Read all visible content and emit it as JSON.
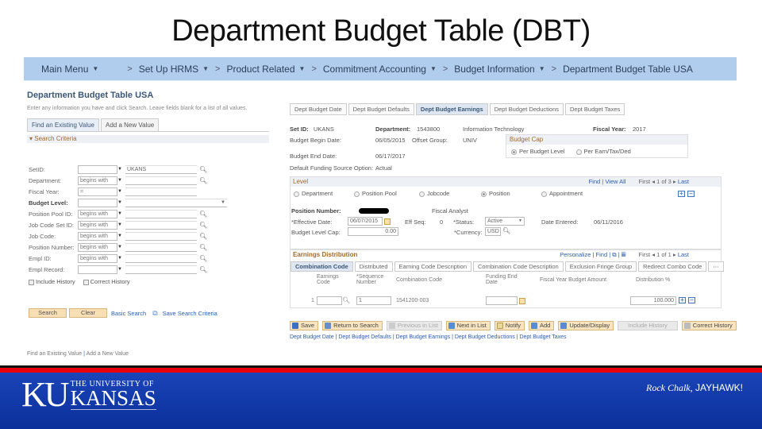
{
  "slide": {
    "title": "Department Budget Table (DBT)"
  },
  "navbar": {
    "crumbs": [
      {
        "label": "Main Menu",
        "dropdown": true
      },
      {
        "label": "Set Up HRMS",
        "dropdown": true
      },
      {
        "label": "Product Related",
        "dropdown": true
      },
      {
        "label": "Commitment Accounting",
        "dropdown": true
      },
      {
        "label": "Budget Information",
        "dropdown": true
      },
      {
        "label": "Department Budget Table USA",
        "dropdown": false
      }
    ],
    "caret": "▼",
    "separator": ">"
  },
  "search_page": {
    "title": "Department Budget Table USA",
    "instructions": "Enter any information you have and click Search. Leave fields blank for a list of all values.",
    "tabs": [
      "Find an Existing Value",
      "Add a New Value"
    ],
    "criteria_header": "Search Criteria",
    "fields": [
      {
        "label": "SetID:",
        "operator": "",
        "value": "UKANS",
        "lookup": true
      },
      {
        "label": "Department:",
        "operator": "begins with",
        "value": "",
        "lookup": true
      },
      {
        "label": "Fiscal Year:",
        "operator": "=",
        "value": "",
        "lookup": false
      },
      {
        "label": "Budget Level:",
        "operator": "",
        "value": "",
        "lookup": false,
        "select": true
      },
      {
        "label": "Position Pool ID:",
        "operator": "begins with",
        "value": "",
        "lookup": true
      },
      {
        "label": "Job Code Set ID:",
        "operator": "begins with",
        "value": "",
        "lookup": true
      },
      {
        "label": "Job Code:",
        "operator": "begins with",
        "value": "",
        "lookup": true
      },
      {
        "label": "Position Number:",
        "operator": "begins with",
        "value": "",
        "lookup": true
      },
      {
        "label": "Empl ID:",
        "operator": "begins with",
        "value": "",
        "lookup": true
      },
      {
        "label": "Empl Record:",
        "operator": "",
        "value": "",
        "lookup": true
      }
    ],
    "checkboxes": [
      "Include History",
      "Correct History"
    ],
    "search_button": "Search",
    "clear_button": "Clear",
    "basic_search_link": "Basic Search",
    "save_criteria_link": "Save Search Criteria",
    "footer_links": [
      "Find an Existing Value",
      "Add a New Value"
    ]
  },
  "detail_page": {
    "tabs": [
      "Dept Budget Date",
      "Dept Budget Defaults",
      "Dept Budget Earnings",
      "Dept Budget Deductions",
      "Dept Budget Taxes"
    ],
    "active_tab": 2,
    "header": {
      "setid_label": "Set ID:",
      "setid": "UKANS",
      "department_label": "Department:",
      "department": "1543800",
      "department_desc": "Information Technology",
      "fiscal_year_label": "Fiscal Year:",
      "fiscal_year": "2017",
      "begin_date_label": "Budget Begin Date:",
      "begin_date": "06/05/2015",
      "offset_group_label": "Offset Group:",
      "offset_group": "UNIV",
      "end_date_label": "Budget End Date:",
      "end_date": "06/17/2017",
      "default_funding_label": "Default Funding Source Option:",
      "default_funding": "Actual"
    },
    "budget_cap": {
      "title": "Budget Cap",
      "options": [
        "Per Budget Level",
        "Per Earn/Tax/Ded"
      ],
      "selected": 0
    },
    "level": {
      "title": "Level",
      "nav": {
        "find": "Find",
        "view_all": "View All",
        "first": "First",
        "count": "1 of 3",
        "last": "Last"
      },
      "options": [
        "Department",
        "Position Pool",
        "Jobcode",
        "Position",
        "Appointment"
      ],
      "selected": 3,
      "position_number_label": "Position Number:",
      "position_desc": "Fiscal Analyst",
      "effective_date_label": "*Effective Date:",
      "effective_date": "06/07/2015",
      "eff_seq_label": "Eff Seq:",
      "eff_seq": "0",
      "status_label": "*Status:",
      "status": "Active",
      "date_entered_label": "Date Entered:",
      "date_entered": "06/11/2016",
      "budget_level_cap_label": "Budget Level Cap:",
      "budget_level_cap": "0.00",
      "currency_label": "*Currency:",
      "currency": "USD"
    },
    "earnings": {
      "title": "Earnings Distribution",
      "nav": {
        "personalize": "Personalize",
        "find": "Find",
        "first": "First",
        "count": "1 of 1",
        "last": "Last"
      },
      "tabs": [
        "Combination Code",
        "Distributed",
        "Earning Code Description",
        "Combination Code Description",
        "Exclusion Fringe Group",
        "Redirect Combo Code"
      ],
      "columns": [
        "Earnings Code",
        "*Sequence Number",
        "Combination Code",
        "Funding End Date",
        "Fiscal Year Budget Amount",
        "Distribution %"
      ],
      "rows": [
        {
          "row": "1",
          "earnings_code": "",
          "sequence": "1",
          "combination_code": "1541200-003",
          "funding_end_date": "",
          "budget_amount": "",
          "distribution": "100.000"
        }
      ]
    },
    "toolbar": [
      {
        "label": "Save",
        "enabled": true,
        "icon": "save-icon",
        "color": "#3b6fc4"
      },
      {
        "label": "Return to Search",
        "enabled": true,
        "icon": "return-icon",
        "color": "#6a8fc4"
      },
      {
        "label": "Previous in List",
        "enabled": false,
        "icon": "previous-icon",
        "color": "#bbb"
      },
      {
        "label": "Next in List",
        "enabled": true,
        "icon": "next-icon",
        "color": "#5a8ad0"
      },
      {
        "label": "Notify",
        "enabled": true,
        "icon": "notify-icon",
        "color": "#d7c27b"
      },
      {
        "label": "Add",
        "enabled": true,
        "icon": "add-icon",
        "color": "#5a8ad0"
      },
      {
        "label": "Update/Display",
        "enabled": true,
        "icon": "update-icon",
        "color": "#5a8ad0"
      },
      {
        "label": "Include History",
        "enabled": false,
        "icon": "",
        "color": ""
      },
      {
        "label": "Correct History",
        "enabled": true,
        "icon": "correct-icon",
        "color": "#aaa"
      }
    ],
    "bottom_links": [
      "Dept Budget Date",
      "Dept Budget Defaults",
      "Dept Budget Earnings",
      "Dept Budget Deductions",
      "Dept Budget Taxes"
    ]
  },
  "branding": {
    "ku": "KU",
    "university_line": "THE UNIVERSITY OF",
    "kansas": "KANSAS",
    "slogan_italic": "Rock Chalk,",
    "slogan_caps": "JAYHAWK!",
    "colors": {
      "blue": "#0b2f9a",
      "red": "#e8000d"
    }
  }
}
